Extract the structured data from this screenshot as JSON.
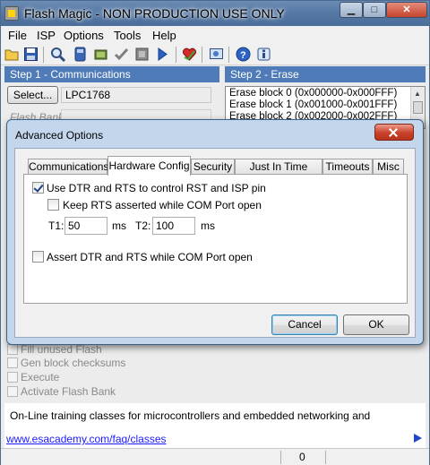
{
  "window": {
    "title": "Flash Magic - NON PRODUCTION USE ONLY",
    "min_glyph": "▁",
    "max_glyph": "□",
    "close_glyph": "✕"
  },
  "menu": [
    "File",
    "ISP",
    "Options",
    "Tools",
    "Help"
  ],
  "toolbar": {
    "icons": [
      "open-icon",
      "save-icon",
      "search-icon",
      "blank-check-icon",
      "erase-icon",
      "verify-icon",
      "program-icon",
      "start-icon",
      "favorite-icon",
      "terminal-icon",
      "help-icon",
      "info-icon"
    ]
  },
  "step1": {
    "header": "Step 1 - Communications",
    "select_label": "Select...",
    "device": "LPC1768",
    "flash_bank_label": "Flash Bank:"
  },
  "step2": {
    "header": "Step 2 - Erase",
    "blocks": [
      "Erase block 0 (0x000000-0x000FFF)",
      "Erase block 1 (0x001000-0x001FFF)",
      "Erase block 2 (0x002000-0x002FFF)"
    ]
  },
  "background_checks": [
    "Fill unused Flash",
    "Gen block checksums",
    "Execute",
    "Activate Flash Bank"
  ],
  "info": {
    "text": "On-Line training classes for microcontrollers and embedded networking and",
    "link": "www.esacademy.com/faq/classes"
  },
  "status": {
    "value": "0"
  },
  "dialog": {
    "title": "Advanced Options",
    "tabs": [
      "Communications",
      "Hardware Config",
      "Security",
      "Just In Time Code",
      "Timeouts",
      "Misc"
    ],
    "active_tab": "Hardware Config",
    "use_dtr_rts": {
      "label": "Use DTR and RTS to control RST and ISP pin",
      "checked": true
    },
    "keep_rts": {
      "label": "Keep RTS asserted while COM Port open",
      "checked": false
    },
    "t1": {
      "label": "T1:",
      "value": "50",
      "unit": "ms"
    },
    "t2": {
      "label": "T2:",
      "value": "100",
      "unit": "ms"
    },
    "assert_dtr_rts": {
      "label": "Assert DTR and RTS while COM Port open",
      "checked": false
    },
    "cancel_label": "Cancel",
    "ok_label": "OK"
  }
}
